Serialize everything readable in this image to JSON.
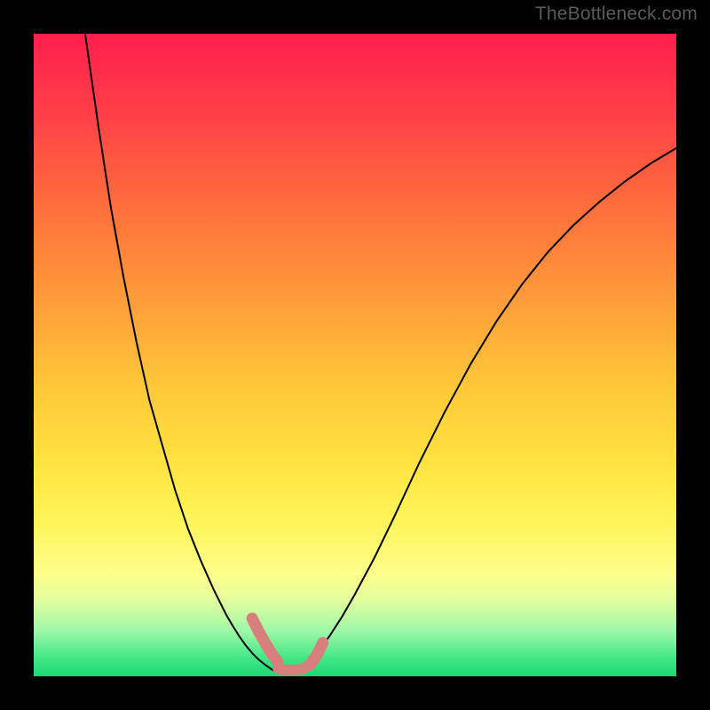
{
  "watermark": "TheBottleneck.com",
  "chart_data": {
    "type": "line",
    "title": "",
    "xlabel": "",
    "ylabel": "",
    "xlim": [
      0,
      100
    ],
    "ylim": [
      0,
      100
    ],
    "grid": false,
    "legend": false,
    "series": [
      {
        "name": "left-curve",
        "x": [
          8,
          9,
          10,
          12,
          14,
          16,
          18,
          20,
          22,
          24,
          26,
          28,
          30,
          31,
          32,
          33,
          34,
          35,
          36,
          37,
          38
        ],
        "y": [
          100,
          93,
          86,
          73,
          62,
          52,
          43,
          36,
          29,
          23,
          18,
          13.5,
          9.5,
          7.8,
          6.2,
          4.8,
          3.6,
          2.6,
          1.8,
          1.1,
          0.5
        ]
      },
      {
        "name": "right-curve",
        "x": [
          41,
          42,
          43,
          44,
          46,
          48,
          50,
          53,
          56,
          60,
          64,
          68,
          72,
          76,
          80,
          84,
          88,
          92,
          96,
          100
        ],
        "y": [
          0.5,
          1.3,
          2.3,
          3.5,
          6.2,
          9.3,
          12.8,
          18.4,
          24.6,
          33.2,
          41.2,
          48.6,
          55.2,
          61.0,
          66.0,
          70.2,
          73.8,
          77.0,
          79.8,
          82.2
        ]
      }
    ],
    "highlight": {
      "left_segment": {
        "x": [
          34,
          35,
          36,
          37,
          38
        ],
        "y": [
          9,
          7,
          5.2,
          3.6,
          2.2
        ]
      },
      "floor_segment": {
        "x": [
          38,
          39,
          40,
          41,
          42,
          43
        ],
        "y": [
          1.2,
          1.0,
          1.0,
          1.0,
          1.2,
          1.8
        ]
      },
      "right_segment": {
        "x": [
          43,
          44,
          45
        ],
        "y": [
          1.8,
          3.2,
          5.2
        ]
      }
    },
    "background_gradient": {
      "direction": "vertical",
      "stops": [
        {
          "pos": 0.0,
          "color": "#ff1f4d"
        },
        {
          "pos": 0.12,
          "color": "#ff3e48"
        },
        {
          "pos": 0.26,
          "color": "#ff6b3c"
        },
        {
          "pos": 0.4,
          "color": "#ff983a"
        },
        {
          "pos": 0.55,
          "color": "#ffc838"
        },
        {
          "pos": 0.67,
          "color": "#ffe340"
        },
        {
          "pos": 0.76,
          "color": "#fff55a"
        },
        {
          "pos": 0.84,
          "color": "#fdfe8b"
        },
        {
          "pos": 0.88,
          "color": "#e5fe9d"
        },
        {
          "pos": 0.93,
          "color": "#9cf8a8"
        },
        {
          "pos": 0.97,
          "color": "#46e886"
        },
        {
          "pos": 1.0,
          "color": "#1bd874"
        }
      ]
    },
    "curve_color": "#000000",
    "marker_color": "#d87f7d"
  }
}
